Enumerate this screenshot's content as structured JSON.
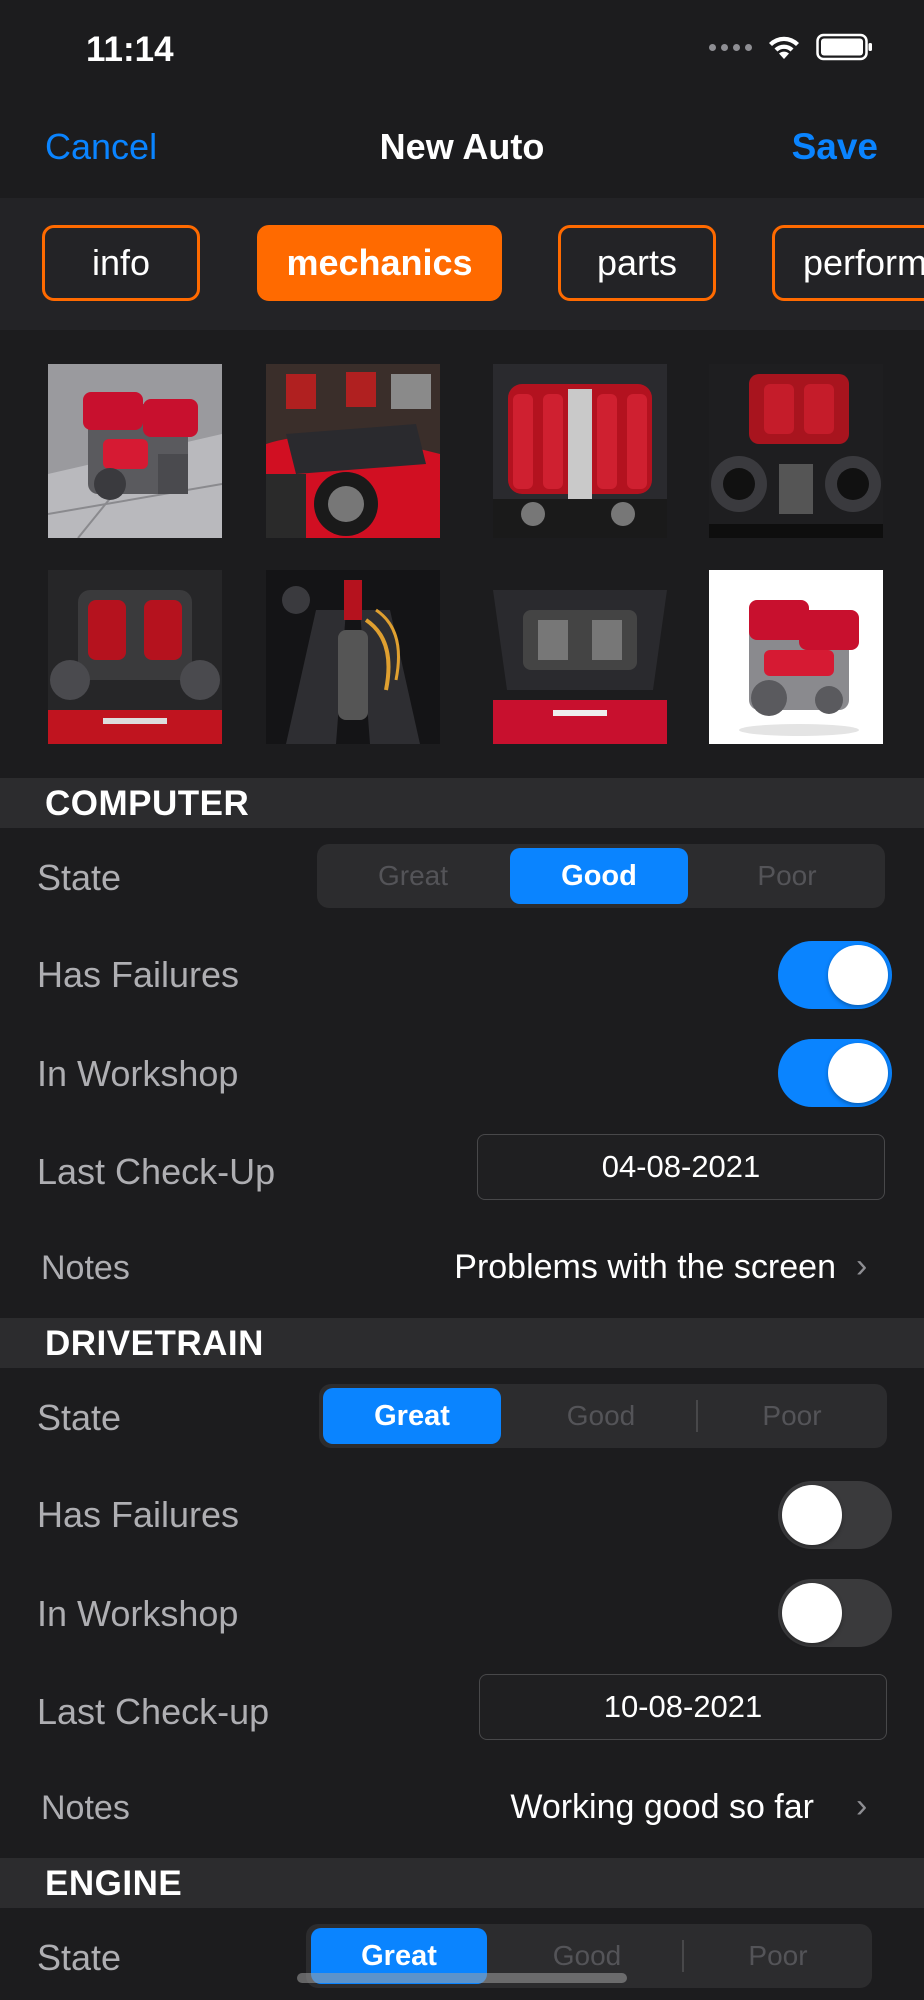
{
  "status_bar": {
    "time": "11:14"
  },
  "nav": {
    "cancel": "Cancel",
    "title": "New Auto",
    "save": "Save"
  },
  "tabs": [
    {
      "label": "info"
    },
    {
      "label": "mechanics"
    },
    {
      "label": "parts"
    },
    {
      "label": "perform"
    }
  ],
  "colors": {
    "accent_orange": "#ff6a00",
    "accent_blue": "#0a84ff",
    "background": "#1c1c1e"
  },
  "sections": {
    "computer": {
      "header": "COMPUTER",
      "state_label": "State",
      "state_options": [
        "Great",
        "Good",
        "Poor"
      ],
      "state_selected": "Good",
      "has_failures_label": "Has Failures",
      "has_failures": true,
      "in_workshop_label": "In Workshop",
      "in_workshop": true,
      "last_checkup_label": "Last Check-Up",
      "last_checkup": "04-08-2021",
      "notes_label": "Notes",
      "notes": "Problems with the screen"
    },
    "drivetrain": {
      "header": "DRIVETRAIN",
      "state_label": "State",
      "state_options": [
        "Great",
        "Good",
        "Poor"
      ],
      "state_selected": "Great",
      "has_failures_label": "Has Failures",
      "has_failures": false,
      "in_workshop_label": "In Workshop",
      "in_workshop": false,
      "last_checkup_label": "Last Check-up",
      "last_checkup": "10-08-2021",
      "notes_label": "Notes",
      "notes": "Working good so far"
    },
    "engine": {
      "header": "ENGINE",
      "state_label": "State",
      "state_options": [
        "Great",
        "Good",
        "Poor"
      ],
      "state_selected": "Great"
    }
  }
}
